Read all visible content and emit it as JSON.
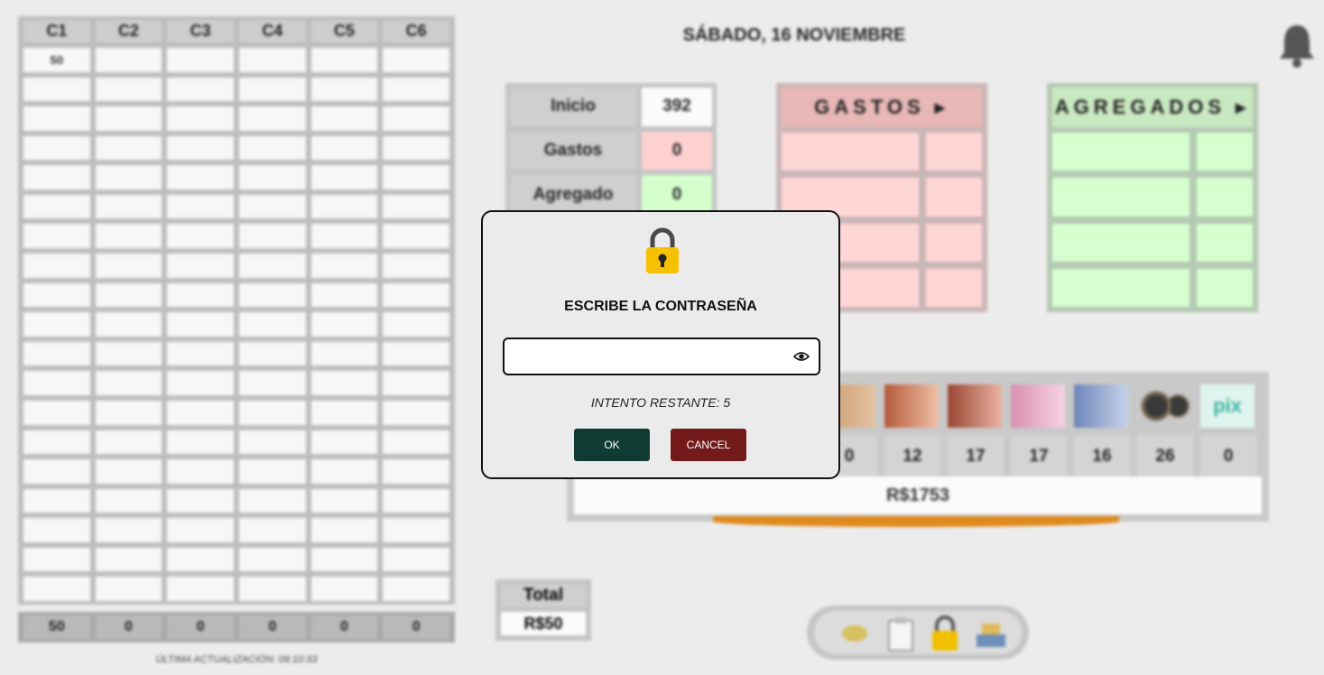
{
  "header": {
    "date": "SÁBADO, 16 NOVIEMBRE"
  },
  "left_table": {
    "columns": [
      "C1",
      "C2",
      "C3",
      "C4",
      "C5",
      "C6"
    ],
    "first_row": [
      "50",
      "",
      "",
      "",
      "",
      ""
    ],
    "totals": [
      "50",
      "0",
      "0",
      "0",
      "0",
      "0"
    ],
    "last_update": "ÚLTIMA ACTUALIZACIÓN: 09:10:33"
  },
  "summary": {
    "inicio_label": "Inicio",
    "inicio_value": "392",
    "gastos_label": "Gastos",
    "gastos_value": "0",
    "agregado_label": "Agregado",
    "agregado_value": "0"
  },
  "gastos_panel": {
    "title": "GASTOS ▸",
    "color": "#ffd6d6"
  },
  "agregados_panel": {
    "title": "AGREGADOS ▸",
    "color": "#d6ffd0"
  },
  "money": {
    "counts": [
      "0",
      "12",
      "17",
      "17",
      "16",
      "26",
      "0"
    ],
    "total": "R$1753",
    "pix_label": "pix"
  },
  "total_box": {
    "label": "Total",
    "value": "R$50"
  },
  "dialog": {
    "title": "ESCRIBE LA CONTRASEÑA",
    "password_value": "",
    "attempts": "INTENTO RESTANTE: 5",
    "ok_label": "OK",
    "cancel_label": "CANCEL",
    "lock_color": "#f5c000",
    "ok_color": "#0f3b33",
    "cancel_color": "#731b1b"
  }
}
